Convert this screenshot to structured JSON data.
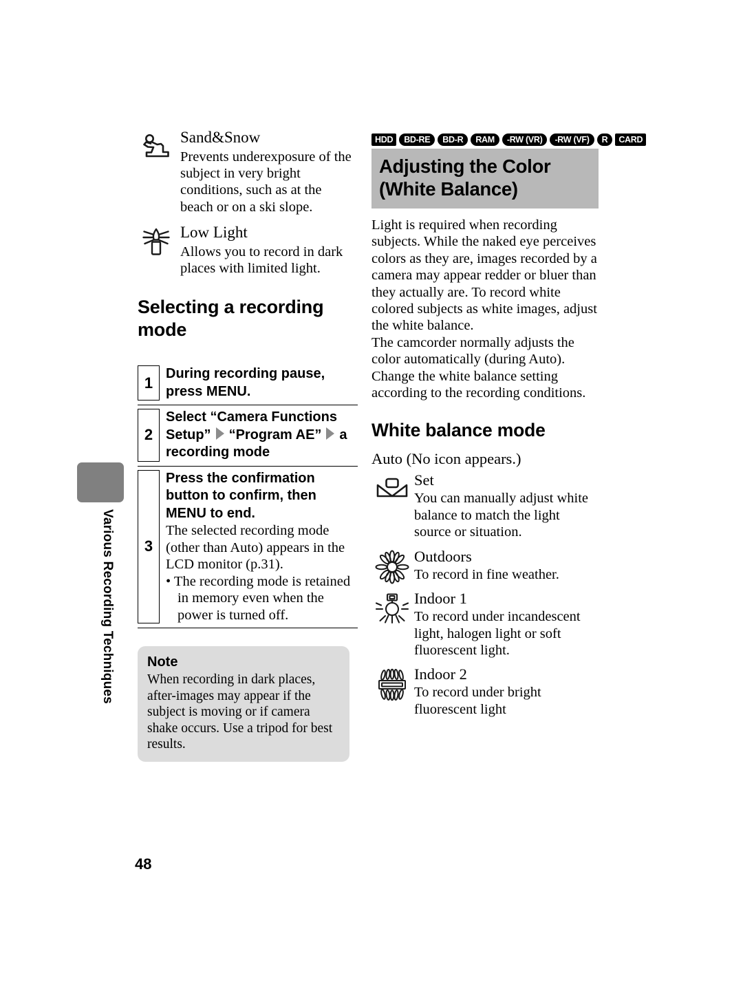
{
  "side_tab": {
    "label": "Various Recording Techniques"
  },
  "left_column": {
    "scene_modes": [
      {
        "icon": "skier-icon",
        "title": "Sand&Snow",
        "description": "Prevents underexposure of the subject in very bright conditions, such as at the beach or on a ski slope."
      },
      {
        "icon": "candle-icon",
        "title": "Low Light",
        "description": "Allows you to record in dark places with limited light."
      }
    ],
    "section_heading": "Selecting a recording mode",
    "steps": [
      {
        "number": "1",
        "bold": "During recording pause, press MENU."
      },
      {
        "number": "2",
        "bold_part_1": "Select “Camera Functions Setup”",
        "bold_part_2": "“Program AE”",
        "bold_part_3": "a recording mode"
      },
      {
        "number": "3",
        "bold": "Press the confirmation button to confirm, then MENU to end.",
        "text": "The selected recording mode (other than Auto) appears in the LCD monitor (p.31).",
        "bullet": "• The recording mode is retained in memory even when the power is turned off."
      }
    ],
    "note": {
      "title": "Note",
      "text": "When recording in dark places, after-images may appear if the subject is moving or if camera shake occurs. Use a tripod for best results."
    }
  },
  "right_column": {
    "media_badges": [
      {
        "label": "HDD",
        "shape": "sq"
      },
      {
        "label": "BD-RE",
        "shape": "round"
      },
      {
        "label": "BD-R",
        "shape": "round"
      },
      {
        "label": "RAM",
        "shape": "round"
      },
      {
        "label": "-RW (VR)",
        "shape": "round"
      },
      {
        "label": "-RW (VF)",
        "shape": "round"
      },
      {
        "label": "R",
        "shape": "round"
      },
      {
        "label": "CARD",
        "shape": "sq"
      }
    ],
    "heading": "Adjusting the Color (White Balance)",
    "intro": "Light is required when recording subjects. While the naked eye perceives colors as they are, images recorded by a camera may appear redder or bluer than they actually are. To record white colored subjects as white images, adjust the white balance.\nThe camcorder normally adjusts the color automatically (during Auto). Change the white balance setting according to the recording conditions.",
    "wb_heading": "White balance mode",
    "wb_auto": "Auto (No icon appears.)",
    "wb_modes": [
      {
        "icon": "white-balance-set-icon",
        "title": "Set",
        "description": "You can manually adjust white balance to match the light source or situation."
      },
      {
        "icon": "sun-outdoors-icon",
        "title": "Outdoors",
        "description": "To record in fine weather."
      },
      {
        "icon": "incandescent-lamp-icon",
        "title": "Indoor 1",
        "description": "To record under incandescent light, halogen light or soft fluorescent light."
      },
      {
        "icon": "fluorescent-tube-icon",
        "title": "Indoor 2",
        "description": "To record under bright fluorescent light"
      }
    ]
  },
  "page_number": "48",
  "colors": {
    "heading_band": "#b8b8b8",
    "note_background": "#dcdcdc",
    "tab_marker": "#808080",
    "arrow": "#8c8c8c"
  }
}
